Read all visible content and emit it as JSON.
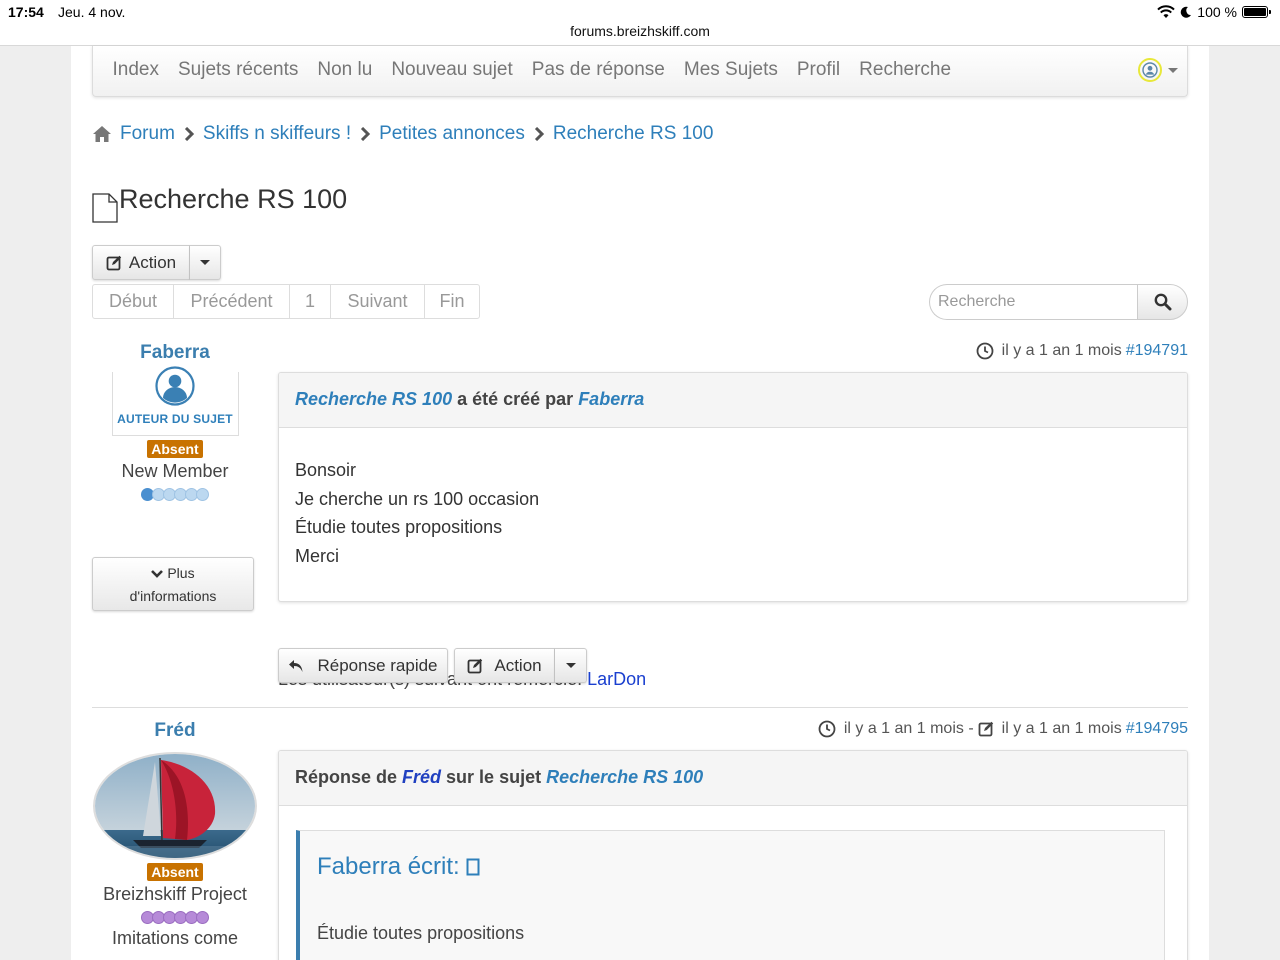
{
  "status_bar": {
    "time": "17:54",
    "date": "Jeu. 4 nov.",
    "battery": "100 %",
    "url": "forums.breizhskiff.com"
  },
  "nav": {
    "items": [
      "Index",
      "Sujets récents",
      "Non lu",
      "Nouveau sujet",
      "Pas de réponse",
      "Mes Sujets",
      "Profil",
      "Recherche"
    ]
  },
  "breadcrumb": [
    "Forum",
    "Skiffs n skiffeurs !",
    "Petites annonces",
    "Recherche RS 100"
  ],
  "topic": {
    "title": "Recherche RS 100"
  },
  "toolbar": {
    "action_label": "Action"
  },
  "pagination": {
    "first": "Début",
    "prev": "Précédent",
    "page": "1",
    "next": "Suivant",
    "last": "Fin"
  },
  "search": {
    "placeholder": "Recherche"
  },
  "posts": [
    {
      "author": "Faberra",
      "author_badge": "AUTEUR DU SUJET",
      "status": "Absent",
      "rank": "New Member",
      "more_line1": "Plus",
      "more_line2": "d'informations",
      "time": "il y a 1 an 1 mois",
      "post_id": "#194791",
      "header_topic": "Recherche RS 100",
      "header_mid": " a été créé par ",
      "header_user": "Faberra",
      "body": [
        "Bonsoir",
        "Je cherche un rs 100 occasion",
        "Étudie toutes propositions",
        "Merci"
      ],
      "thanks_prefix": "Les utilisateur(s) suivant ont remercié: ",
      "thanks_user": "LarDon",
      "quick_reply": "Réponse rapide",
      "action": "Action"
    },
    {
      "author": "Fréd",
      "status": "Absent",
      "rank": "Breizhskiff Project",
      "rank_extra": "Imitations come",
      "time": "il y a 1 an 1 mois -",
      "edit_time": "il y a 1 an 1 mois",
      "post_id": "#194795",
      "header_prefix": "Réponse de ",
      "header_user": "Fréd",
      "header_mid": " sur le sujet ",
      "header_topic": "Recherche RS 100",
      "quote_title": "Faberra écrit: ",
      "quote_text": "Étudie toutes propositions"
    }
  ],
  "colors": {
    "link": "#2e7fba",
    "status_badge": "#c87200",
    "rank_dot_new": "#5b9bd5",
    "rank_dot_project": "#b68ad8"
  }
}
